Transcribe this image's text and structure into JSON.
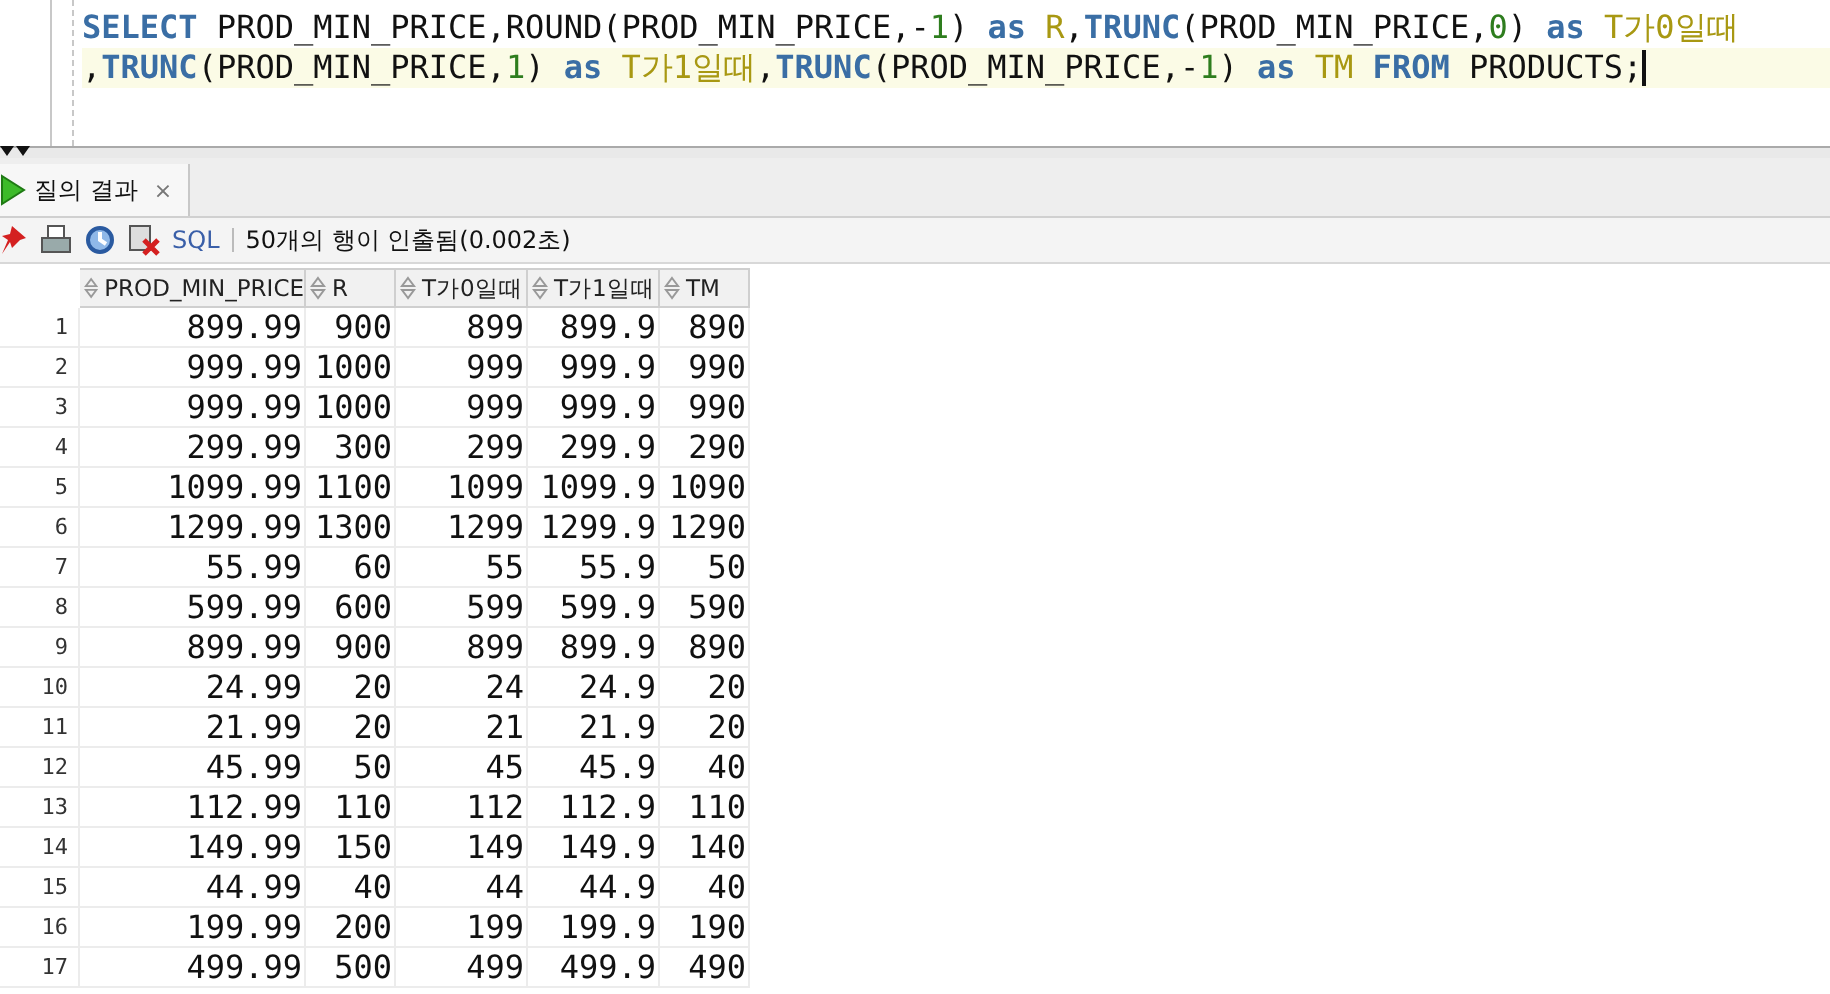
{
  "editor": {
    "lines": [
      {
        "current": false,
        "tokens": [
          {
            "kind": "keyword",
            "text": "SELECT"
          },
          {
            "kind": "plain",
            "text": " PROD_MIN_PRICE,ROUND(PROD_MIN_PRICE,-"
          },
          {
            "kind": "number",
            "text": "1"
          },
          {
            "kind": "plain",
            "text": ") "
          },
          {
            "kind": "keyword",
            "text": "as"
          },
          {
            "kind": "alias",
            "text": " R"
          },
          {
            "kind": "plain",
            "text": ","
          },
          {
            "kind": "keyword",
            "text": "TRUNC"
          },
          {
            "kind": "plain",
            "text": "(PROD_MIN_PRICE,"
          },
          {
            "kind": "number",
            "text": "0"
          },
          {
            "kind": "plain",
            "text": ") "
          },
          {
            "kind": "keyword",
            "text": "as"
          },
          {
            "kind": "alias",
            "text": " T가0일때"
          }
        ]
      },
      {
        "current": true,
        "tokens": [
          {
            "kind": "plain",
            "text": ","
          },
          {
            "kind": "keyword",
            "text": "TRUNC"
          },
          {
            "kind": "plain",
            "text": "(PROD_MIN_PRICE,"
          },
          {
            "kind": "number",
            "text": "1"
          },
          {
            "kind": "plain",
            "text": ") "
          },
          {
            "kind": "keyword",
            "text": "as"
          },
          {
            "kind": "alias",
            "text": " T가1일때"
          },
          {
            "kind": "plain",
            "text": ","
          },
          {
            "kind": "keyword",
            "text": "TRUNC"
          },
          {
            "kind": "plain",
            "text": "(PROD_MIN_PRICE,-"
          },
          {
            "kind": "number",
            "text": "1"
          },
          {
            "kind": "plain",
            "text": ") "
          },
          {
            "kind": "keyword",
            "text": "as"
          },
          {
            "kind": "alias",
            "text": " TM"
          },
          {
            "kind": "keyword",
            "text": " FROM"
          },
          {
            "kind": "plain",
            "text": " PRODUCTS;"
          }
        ]
      }
    ]
  },
  "tabs": [
    {
      "label": "질의 결과",
      "close": "×",
      "selected": true
    }
  ],
  "toolbar": {
    "sql_link": "SQL",
    "status": "50개의 행이 인출됨(0.002초)"
  },
  "table": {
    "columns": [
      "PROD_MIN_PRICE",
      "R",
      "T가0일때",
      "T가1일때",
      "TM"
    ],
    "rows": [
      {
        "n": "1",
        "cells": [
          "899.99",
          "900",
          "899",
          "899.9",
          "890"
        ]
      },
      {
        "n": "2",
        "cells": [
          "999.99",
          "1000",
          "999",
          "999.9",
          "990"
        ]
      },
      {
        "n": "3",
        "cells": [
          "999.99",
          "1000",
          "999",
          "999.9",
          "990"
        ]
      },
      {
        "n": "4",
        "cells": [
          "299.99",
          "300",
          "299",
          "299.9",
          "290"
        ]
      },
      {
        "n": "5",
        "cells": [
          "1099.99",
          "1100",
          "1099",
          "1099.9",
          "1090"
        ]
      },
      {
        "n": "6",
        "cells": [
          "1299.99",
          "1300",
          "1299",
          "1299.9",
          "1290"
        ]
      },
      {
        "n": "7",
        "cells": [
          "55.99",
          "60",
          "55",
          "55.9",
          "50"
        ]
      },
      {
        "n": "8",
        "cells": [
          "599.99",
          "600",
          "599",
          "599.9",
          "590"
        ]
      },
      {
        "n": "9",
        "cells": [
          "899.99",
          "900",
          "899",
          "899.9",
          "890"
        ]
      },
      {
        "n": "10",
        "cells": [
          "24.99",
          "20",
          "24",
          "24.9",
          "20"
        ]
      },
      {
        "n": "11",
        "cells": [
          "21.99",
          "20",
          "21",
          "21.9",
          "20"
        ]
      },
      {
        "n": "12",
        "cells": [
          "45.99",
          "50",
          "45",
          "45.9",
          "40"
        ]
      },
      {
        "n": "13",
        "cells": [
          "112.99",
          "110",
          "112",
          "112.9",
          "110"
        ]
      },
      {
        "n": "14",
        "cells": [
          "149.99",
          "150",
          "149",
          "149.9",
          "140"
        ]
      },
      {
        "n": "15",
        "cells": [
          "44.99",
          "40",
          "44",
          "44.9",
          "40"
        ]
      },
      {
        "n": "16",
        "cells": [
          "199.99",
          "200",
          "199",
          "199.9",
          "190"
        ]
      },
      {
        "n": "17",
        "cells": [
          "499.99",
          "500",
          "499",
          "499.9",
          "490"
        ]
      }
    ]
  }
}
